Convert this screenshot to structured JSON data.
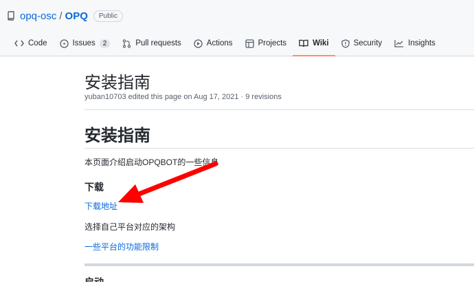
{
  "repo": {
    "owner": "opq-osc",
    "separator": "/",
    "name": "OPQ",
    "visibility": "Public"
  },
  "tabs": [
    {
      "label": "Code",
      "icon": "code-icon"
    },
    {
      "label": "Issues",
      "icon": "issue-opened-icon",
      "count": "2"
    },
    {
      "label": "Pull requests",
      "icon": "git-pull-request-icon"
    },
    {
      "label": "Actions",
      "icon": "play-icon"
    },
    {
      "label": "Projects",
      "icon": "table-icon"
    },
    {
      "label": "Wiki",
      "icon": "book-icon",
      "selected": true
    },
    {
      "label": "Security",
      "icon": "shield-icon"
    },
    {
      "label": "Insights",
      "icon": "graph-icon"
    }
  ],
  "wiki": {
    "title": "安装指南",
    "meta": "yuban10703 edited this page on Aug 17, 2021 · 9 revisions",
    "heading": "安装指南",
    "intro": "本页面介绍启动OPQBOT的一些信息",
    "download_heading": "下载",
    "download_link": "下载地址",
    "choose_arch": "选择自己平台对应的架构",
    "limits_link": "一些平台的功能限制",
    "next_heading": "启动"
  },
  "annotation": {
    "arrow_color": "#ff0000"
  },
  "colors": {
    "link": "#0969da",
    "tab_underline": "#fd8c73"
  }
}
